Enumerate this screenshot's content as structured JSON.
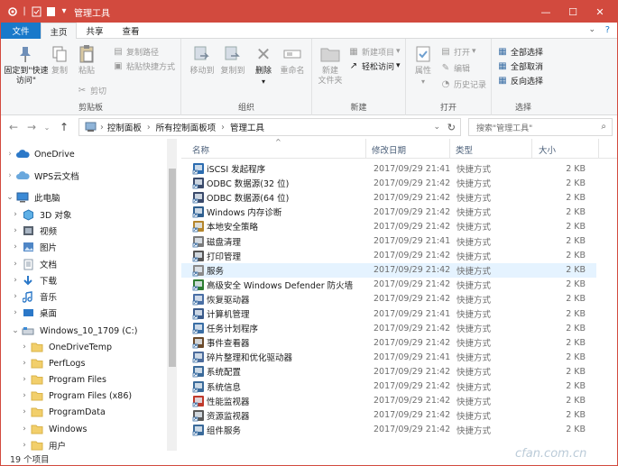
{
  "window": {
    "title": "管理工具"
  },
  "tabs": [
    {
      "label": "文件"
    },
    {
      "label": "主页"
    },
    {
      "label": "共享"
    },
    {
      "label": "查看"
    }
  ],
  "ribbon": {
    "clipboard": {
      "pin_quick_access": "固定到\"快速访问\"",
      "copy": "复制",
      "paste": "粘贴",
      "copy_path": "复制路径",
      "paste_shortcut": "粘贴快捷方式",
      "cut": "剪切",
      "group_label": "剪贴板"
    },
    "organize": {
      "move_to": "移动到",
      "copy_to": "复制到",
      "delete": "删除",
      "rename": "重命名",
      "group_label": "组织"
    },
    "new": {
      "new_folder": "新建\n文件夹",
      "new_item": "新建项目",
      "easy_access": "轻松访问",
      "group_label": "新建"
    },
    "open": {
      "properties": "属性",
      "open": "打开",
      "edit": "编辑",
      "history": "历史记录",
      "group_label": "打开"
    },
    "select": {
      "select_all": "全部选择",
      "select_none": "全部取消",
      "invert": "反向选择",
      "group_label": "选择"
    }
  },
  "address": {
    "crumbs": [
      "控制面板",
      "所有控制面板项",
      "管理工具"
    ],
    "search_placeholder": "搜索\"管理工具\""
  },
  "nav": {
    "items": [
      {
        "label": "OneDrive",
        "level": 0,
        "icon": "cloud-icon"
      },
      {
        "label": "WPS云文档",
        "level": 0,
        "icon": "cloud-icon"
      },
      {
        "label": "此电脑",
        "level": 0,
        "icon": "computer-icon"
      },
      {
        "label": "3D 对象",
        "level": 1,
        "icon": "cube-icon"
      },
      {
        "label": "视频",
        "level": 1,
        "icon": "video-icon"
      },
      {
        "label": "图片",
        "level": 1,
        "icon": "picture-icon"
      },
      {
        "label": "文档",
        "level": 1,
        "icon": "document-icon"
      },
      {
        "label": "下载",
        "level": 1,
        "icon": "download-icon"
      },
      {
        "label": "音乐",
        "level": 1,
        "icon": "music-icon"
      },
      {
        "label": "桌面",
        "level": 1,
        "icon": "desktop-icon"
      },
      {
        "label": "Windows_10_1709 (C:)",
        "level": 1,
        "icon": "drive-icon"
      },
      {
        "label": "OneDriveTemp",
        "level": 2,
        "icon": "folder-icon"
      },
      {
        "label": "PerfLogs",
        "level": 2,
        "icon": "folder-icon"
      },
      {
        "label": "Program Files",
        "level": 2,
        "icon": "folder-icon"
      },
      {
        "label": "Program Files (x86)",
        "level": 2,
        "icon": "folder-icon"
      },
      {
        "label": "ProgramData",
        "level": 2,
        "icon": "folder-icon"
      },
      {
        "label": "Windows",
        "level": 2,
        "icon": "folder-icon"
      },
      {
        "label": "用户",
        "level": 2,
        "icon": "folder-icon"
      }
    ]
  },
  "columns": {
    "name": "名称",
    "date": "修改日期",
    "type": "类型",
    "size": "大小"
  },
  "files": [
    {
      "name": "iSCSI 发起程序",
      "date": "2017/09/29 21:41",
      "type": "快捷方式",
      "size": "2 KB",
      "color": "#2b6cb0"
    },
    {
      "name": "ODBC 数据源(32 位)",
      "date": "2017/09/29 21:42",
      "type": "快捷方式",
      "size": "2 KB",
      "color": "#3a4a6b"
    },
    {
      "name": "ODBC 数据源(64 位)",
      "date": "2017/09/29 21:42",
      "type": "快捷方式",
      "size": "2 KB",
      "color": "#3a4a6b"
    },
    {
      "name": "Windows 内存诊断",
      "date": "2017/09/29 21:42",
      "type": "快捷方式",
      "size": "2 KB",
      "color": "#2f5f8f"
    },
    {
      "name": "本地安全策略",
      "date": "2017/09/29 21:42",
      "type": "快捷方式",
      "size": "2 KB",
      "color": "#b5862c"
    },
    {
      "name": "磁盘清理",
      "date": "2017/09/29 21:41",
      "type": "快捷方式",
      "size": "2 KB",
      "color": "#7a7a7a"
    },
    {
      "name": "打印管理",
      "date": "2017/09/29 21:42",
      "type": "快捷方式",
      "size": "2 KB",
      "color": "#555555"
    },
    {
      "name": "服务",
      "date": "2017/09/29 21:42",
      "type": "快捷方式",
      "size": "2 KB",
      "color": "#8a8a8a",
      "selected": true
    },
    {
      "name": "高级安全 Windows Defender 防火墙",
      "date": "2017/09/29 21:42",
      "type": "快捷方式",
      "size": "2 KB",
      "color": "#2e7d32"
    },
    {
      "name": "恢复驱动器",
      "date": "2017/09/29 21:42",
      "type": "快捷方式",
      "size": "2 KB",
      "color": "#4a6fa5"
    },
    {
      "name": "计算机管理",
      "date": "2017/09/29 21:41",
      "type": "快捷方式",
      "size": "2 KB",
      "color": "#3a5a8a"
    },
    {
      "name": "任务计划程序",
      "date": "2017/09/29 21:42",
      "type": "快捷方式",
      "size": "2 KB",
      "color": "#3a6ea5"
    },
    {
      "name": "事件查看器",
      "date": "2017/09/29 21:42",
      "type": "快捷方式",
      "size": "2 KB",
      "color": "#6b4a2b"
    },
    {
      "name": "碎片整理和优化驱动器",
      "date": "2017/09/29 21:41",
      "type": "快捷方式",
      "size": "2 KB",
      "color": "#4c6c9c"
    },
    {
      "name": "系统配置",
      "date": "2017/09/29 21:42",
      "type": "快捷方式",
      "size": "2 KB",
      "color": "#3a6a9a"
    },
    {
      "name": "系统信息",
      "date": "2017/09/29 21:42",
      "type": "快捷方式",
      "size": "2 KB",
      "color": "#3a6a9a"
    },
    {
      "name": "性能监视器",
      "date": "2017/09/29 21:42",
      "type": "快捷方式",
      "size": "2 KB",
      "color": "#c0392b"
    },
    {
      "name": "资源监视器",
      "date": "2017/09/29 21:42",
      "type": "快捷方式",
      "size": "2 KB",
      "color": "#5a5a5a"
    },
    {
      "name": "组件服务",
      "date": "2017/09/29 21:42",
      "type": "快捷方式",
      "size": "2 KB",
      "color": "#3a6a9a"
    }
  ],
  "status": {
    "count": "19 个项目"
  },
  "watermark": "cfan.com.cn",
  "colors": {
    "titlebar": "#d24a3e",
    "accent": "#1979ca",
    "selected_row": "#e5f3ff"
  }
}
